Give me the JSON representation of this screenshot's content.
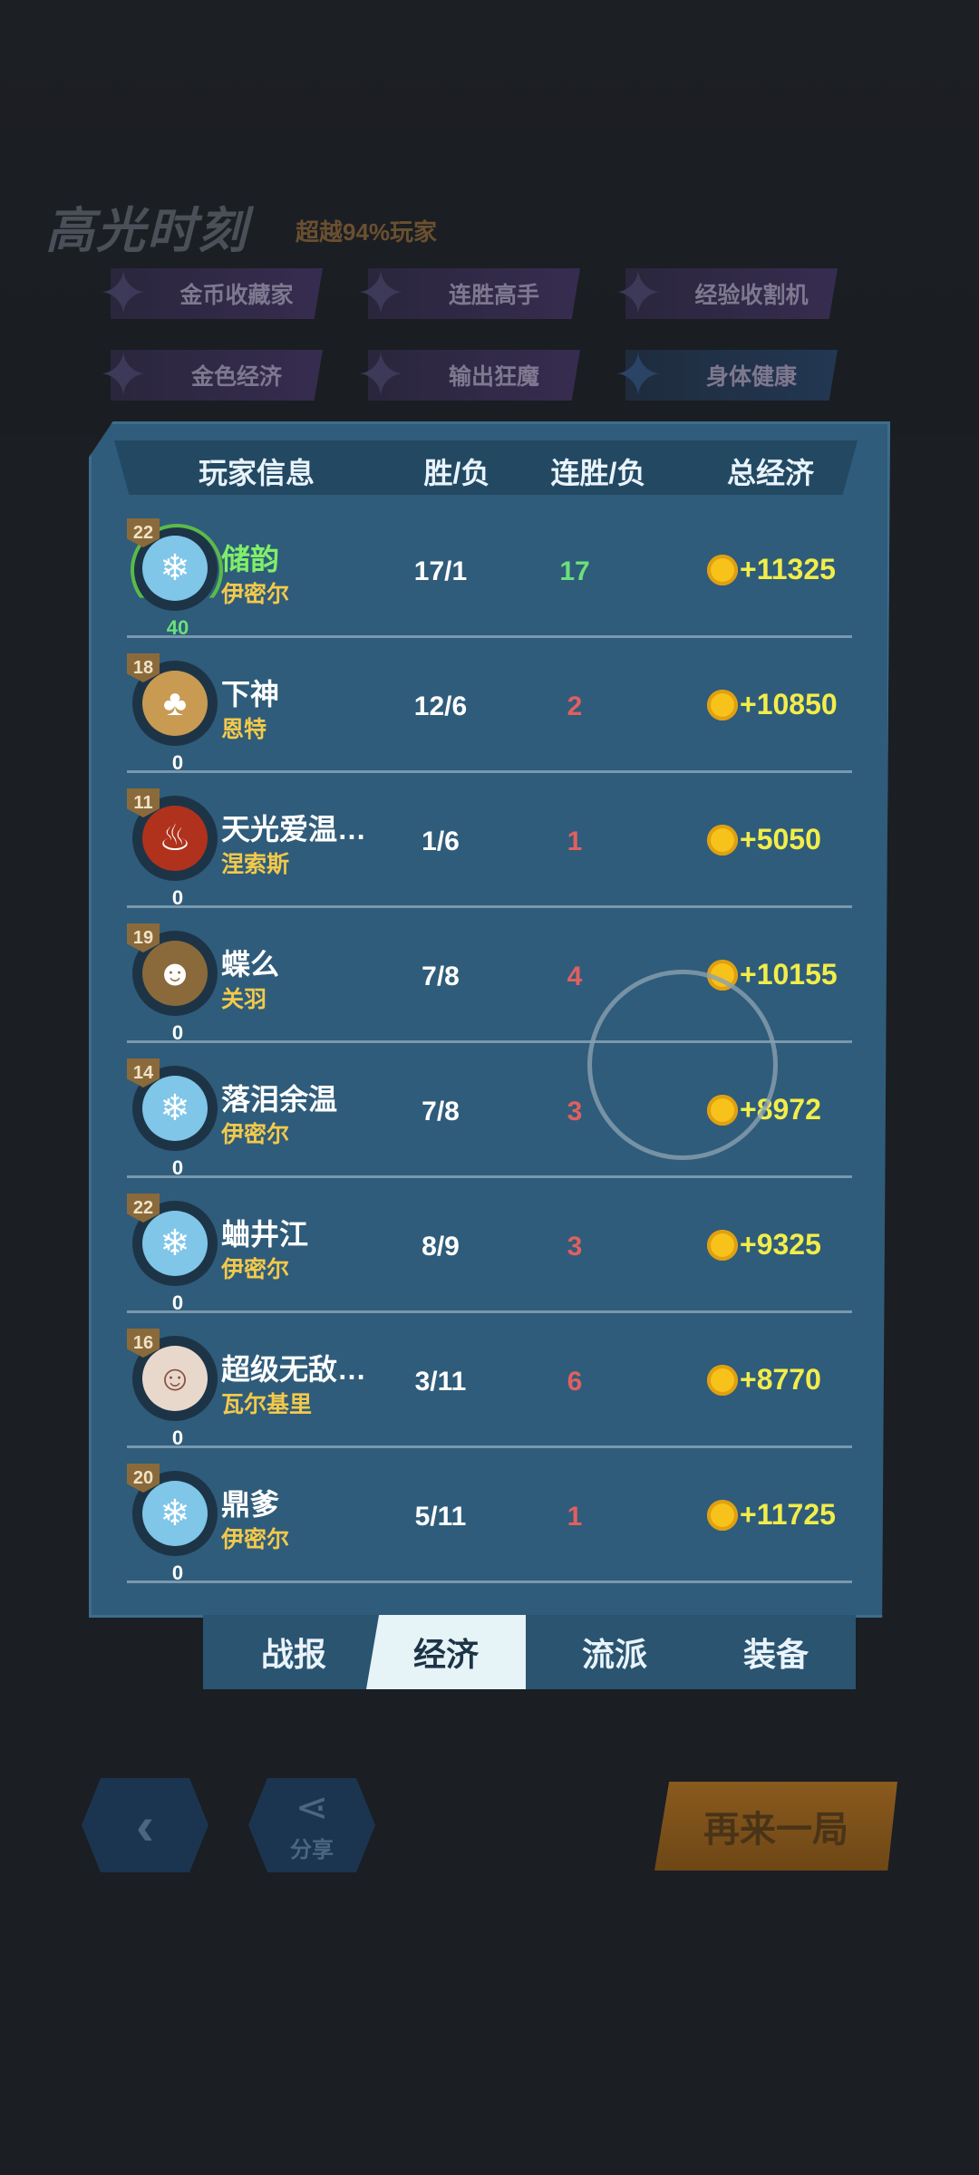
{
  "highlight": {
    "title": "高光时刻",
    "subtitle": "超越94%玩家",
    "badges": [
      {
        "label": "金币收藏家"
      },
      {
        "label": "连胜高手"
      },
      {
        "label": "经验收割机"
      },
      {
        "label": "金色经济"
      },
      {
        "label": "输出狂魔"
      },
      {
        "label": "身体健康"
      }
    ]
  },
  "table": {
    "headers": {
      "player": "玩家信息",
      "win_loss": "胜/负",
      "streak": "连胜/负",
      "economy": "总经济"
    },
    "rows": [
      {
        "level": "22",
        "points": "40",
        "name": "储韵",
        "hero": "伊密尔",
        "wl": "17/1",
        "streak": "17",
        "gold": "+11325"
      },
      {
        "level": "18",
        "points": "0",
        "name": "下神",
        "hero": "恩特",
        "wl": "12/6",
        "streak": "2",
        "gold": "+10850"
      },
      {
        "level": "11",
        "points": "0",
        "name": "天光爱温…",
        "hero": "涅索斯",
        "wl": "1/6",
        "streak": "1",
        "gold": "+5050"
      },
      {
        "level": "19",
        "points": "0",
        "name": "蝶么",
        "hero": "关羽",
        "wl": "7/8",
        "streak": "4",
        "gold": "+10155"
      },
      {
        "level": "14",
        "points": "0",
        "name": "落泪余温",
        "hero": "伊密尔",
        "wl": "7/8",
        "streak": "3",
        "gold": "+8972"
      },
      {
        "level": "22",
        "points": "0",
        "name": "蛐井江",
        "hero": "伊密尔",
        "wl": "8/9",
        "streak": "3",
        "gold": "+9325"
      },
      {
        "level": "16",
        "points": "0",
        "name": "超级无敌…",
        "hero": "瓦尔基里",
        "wl": "3/11",
        "streak": "6",
        "gold": "+8770"
      },
      {
        "level": "20",
        "points": "0",
        "name": "鼎爹",
        "hero": "伊密尔",
        "wl": "5/11",
        "streak": "1",
        "gold": "+11725"
      }
    ]
  },
  "tabs": [
    {
      "label": "战报"
    },
    {
      "label": "经济"
    },
    {
      "label": "流派"
    },
    {
      "label": "装备"
    }
  ],
  "buttons": {
    "back_icon": "back-icon",
    "share_label": "分享",
    "play_again": "再来一局"
  }
}
